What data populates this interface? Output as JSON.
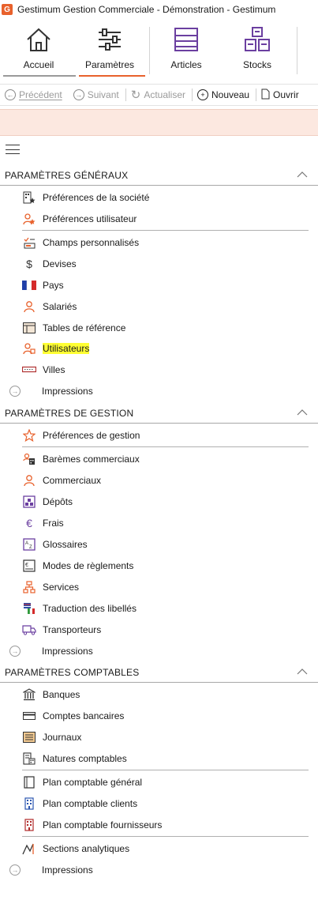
{
  "window": {
    "title": "Gestimum Gestion Commerciale - Démonstration - Gestimum",
    "logo_letter": "G"
  },
  "ribbon": {
    "accueil": "Accueil",
    "parametres": "Paramètres",
    "articles": "Articles",
    "stocks": "Stocks"
  },
  "toolbar": {
    "precedent": "Précédent",
    "suivant": "Suivant",
    "actualiser": "Actualiser",
    "nouveau": "Nouveau",
    "ouvrir": "Ouvrir"
  },
  "colors": {
    "accent": "#e8612c",
    "highlight": "#ffff33",
    "notice_bg": "#fce8e0"
  },
  "sections": {
    "generaux": {
      "title": "PARAMÈTRES GÉNÉRAUX",
      "items": [
        "Préférences de la société",
        "Préférences utilisateur",
        "Champs personnalisés",
        "Devises",
        "Pays",
        "Salariés",
        "Tables de référence",
        "Utilisateurs",
        "Villes"
      ],
      "impressions": "Impressions"
    },
    "gestion": {
      "title": "PARAMÈTRES DE GESTION",
      "items": [
        "Préférences de gestion",
        "Barèmes commerciaux",
        "Commerciaux",
        "Dépôts",
        "Frais",
        "Glossaires",
        "Modes de règlements",
        "Services",
        "Traduction des libellés",
        "Transporteurs"
      ],
      "impressions": "Impressions"
    },
    "comptables": {
      "title": "PARAMÈTRES COMPTABLES",
      "items": [
        "Banques",
        "Comptes bancaires",
        "Journaux",
        "Natures comptables",
        "Plan comptable général",
        "Plan comptable clients",
        "Plan comptable fournisseurs",
        "Sections analytiques"
      ],
      "impressions": "Impressions"
    }
  }
}
